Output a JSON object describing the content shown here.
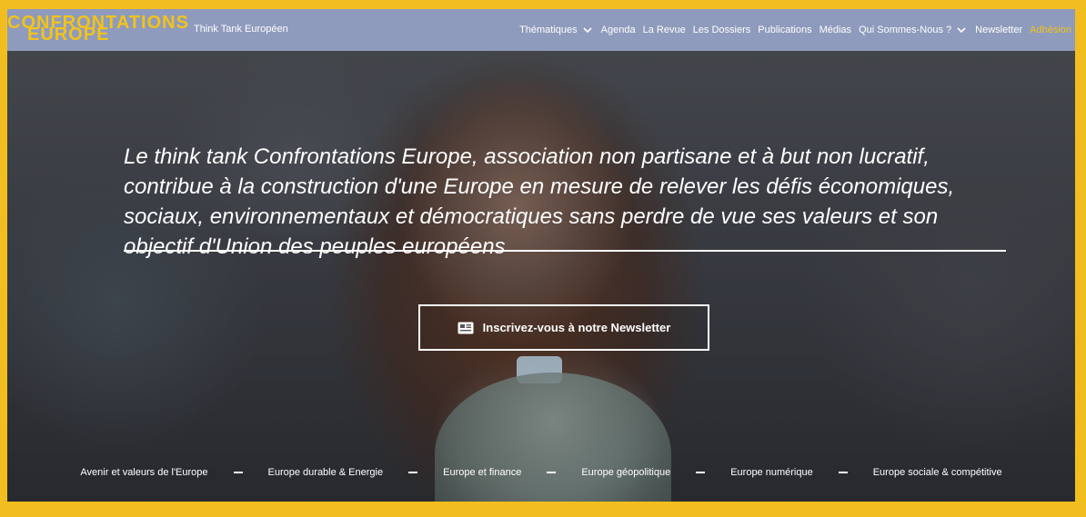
{
  "header": {
    "logo_line1": "CONFRONTATIONS",
    "logo_line2": "EUROPE",
    "tagline": "Think Tank Européen"
  },
  "nav": {
    "items": [
      {
        "label": "Thématiques",
        "dropdown": true
      },
      {
        "label": "Agenda"
      },
      {
        "label": "La Revue"
      },
      {
        "label": "Les Dossiers"
      },
      {
        "label": "Publications"
      },
      {
        "label": "Médias"
      },
      {
        "label": "Qui Sommes-Nous ?",
        "dropdown": true
      },
      {
        "label": "Newsletter"
      },
      {
        "label": "Adhésion",
        "accent": true
      }
    ]
  },
  "hero": {
    "mission_text": "Le think tank Confrontations Europe, association non partisane et à but non lucratif, contribue à la construction d'une Europe en mesure de relever les défis économiques, sociaux, environnementaux et démocratiques sans perdre de vue ses valeurs et son objectif d'Union des peuples européens",
    "newsletter_button": "Inscrivez-vous à notre Newsletter",
    "newsletter_icon": "newspaper-icon"
  },
  "themes": [
    "Avenir et valeurs de l'Europe",
    "Europe durable & Energie",
    "Europe et finance",
    "Europe géopolitique",
    "Europe numérique",
    "Europe sociale & compétitive"
  ],
  "colors": {
    "accent": "#f2c318",
    "navbar": "#8f9bbd",
    "frame": "#f2bd1e",
    "text": "#ffffff"
  }
}
